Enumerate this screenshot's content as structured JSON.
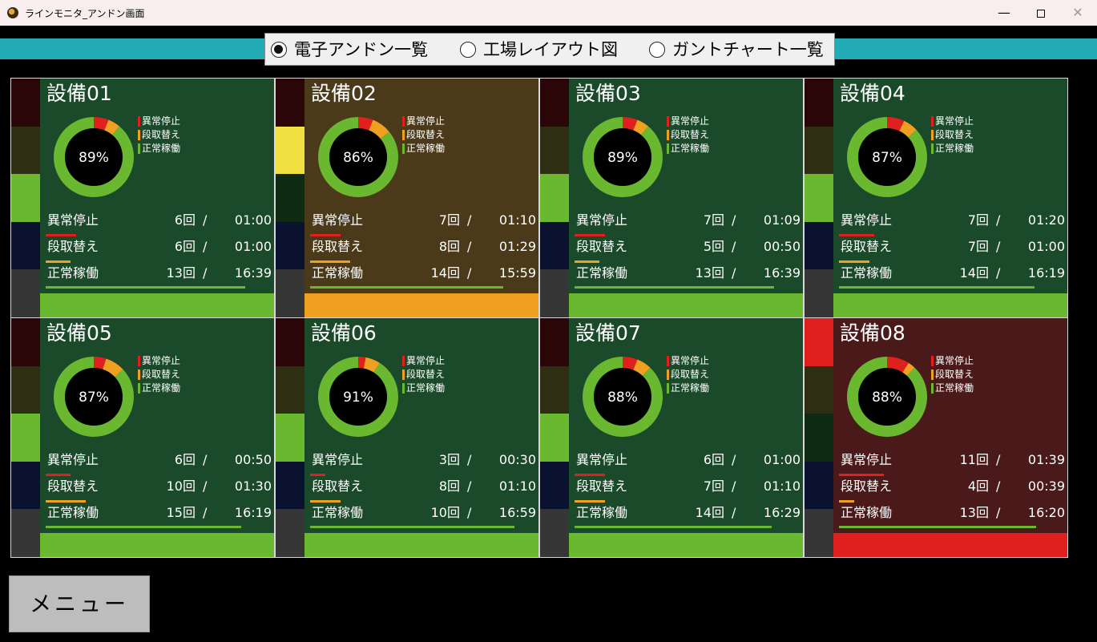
{
  "window": {
    "title": "ラインモニタ_アンドン画面"
  },
  "view_options": [
    {
      "label": "電子アンドン一覧",
      "selected": true
    },
    {
      "label": "工場レイアウト図",
      "selected": false
    },
    {
      "label": "ガントチャート一覧",
      "selected": false
    }
  ],
  "legend": {
    "stop": "異常停止",
    "setup": "段取替え",
    "run": "正常稼働"
  },
  "colors": {
    "green_bg": "#1b4a2a",
    "brown_bg": "#4a3a1a",
    "red_bg": "#4a1a1a",
    "run": "#6ab830",
    "setup": "#f0a020",
    "stop": "#e0201e"
  },
  "machines": [
    {
      "name": "設備01",
      "percent": "89%",
      "rate": 0.89,
      "stop": {
        "label": "異常停止",
        "count": "6回",
        "time": "01:00",
        "share": 0.06
      },
      "setup": {
        "label": "段取替え",
        "count": "6回",
        "time": "01:00",
        "share": 0.05
      },
      "run": {
        "label": "正常稼働",
        "count": "13回",
        "time": "16:39",
        "share": 0.89
      },
      "state": "run"
    },
    {
      "name": "設備02",
      "percent": "86%",
      "rate": 0.86,
      "stop": {
        "label": "異常停止",
        "count": "7回",
        "time": "01:10",
        "share": 0.06
      },
      "setup": {
        "label": "段取替え",
        "count": "8回",
        "time": "01:29",
        "share": 0.08
      },
      "run": {
        "label": "正常稼働",
        "count": "14回",
        "time": "15:59",
        "share": 0.86
      },
      "state": "setup"
    },
    {
      "name": "設備03",
      "percent": "89%",
      "rate": 0.89,
      "stop": {
        "label": "異常停止",
        "count": "7回",
        "time": "01:09",
        "share": 0.06
      },
      "setup": {
        "label": "段取替え",
        "count": "5回",
        "time": "00:50",
        "share": 0.05
      },
      "run": {
        "label": "正常稼働",
        "count": "13回",
        "time": "16:39",
        "share": 0.89
      },
      "state": "run"
    },
    {
      "name": "設備04",
      "percent": "87%",
      "rate": 0.87,
      "stop": {
        "label": "異常停止",
        "count": "7回",
        "time": "01:20",
        "share": 0.07
      },
      "setup": {
        "label": "段取替え",
        "count": "7回",
        "time": "01:00",
        "share": 0.06
      },
      "run": {
        "label": "正常稼働",
        "count": "14回",
        "time": "16:19",
        "share": 0.87
      },
      "state": "run"
    },
    {
      "name": "設備05",
      "percent": "87%",
      "rate": 0.87,
      "stop": {
        "label": "異常停止",
        "count": "6回",
        "time": "00:50",
        "share": 0.05
      },
      "setup": {
        "label": "段取替え",
        "count": "10回",
        "time": "01:30",
        "share": 0.08
      },
      "run": {
        "label": "正常稼働",
        "count": "15回",
        "time": "16:19",
        "share": 0.87
      },
      "state": "run"
    },
    {
      "name": "設備06",
      "percent": "91%",
      "rate": 0.91,
      "stop": {
        "label": "異常停止",
        "count": "3回",
        "time": "00:30",
        "share": 0.03
      },
      "setup": {
        "label": "段取替え",
        "count": "8回",
        "time": "01:10",
        "share": 0.06
      },
      "run": {
        "label": "正常稼働",
        "count": "10回",
        "time": "16:59",
        "share": 0.91
      },
      "state": "run"
    },
    {
      "name": "設備07",
      "percent": "88%",
      "rate": 0.88,
      "stop": {
        "label": "異常停止",
        "count": "6回",
        "time": "01:00",
        "share": 0.06
      },
      "setup": {
        "label": "段取替え",
        "count": "7回",
        "time": "01:10",
        "share": 0.06
      },
      "run": {
        "label": "正常稼働",
        "count": "14回",
        "time": "16:29",
        "share": 0.88
      },
      "state": "run"
    },
    {
      "name": "設備08",
      "percent": "88%",
      "rate": 0.88,
      "stop": {
        "label": "異常停止",
        "count": "11回",
        "time": "01:39",
        "share": 0.09
      },
      "setup": {
        "label": "段取替え",
        "count": "4回",
        "time": "00:39",
        "share": 0.03
      },
      "run": {
        "label": "正常稼働",
        "count": "13回",
        "time": "16:20",
        "share": 0.88
      },
      "state": "stop"
    }
  ],
  "menu": {
    "label": "メニュー"
  }
}
